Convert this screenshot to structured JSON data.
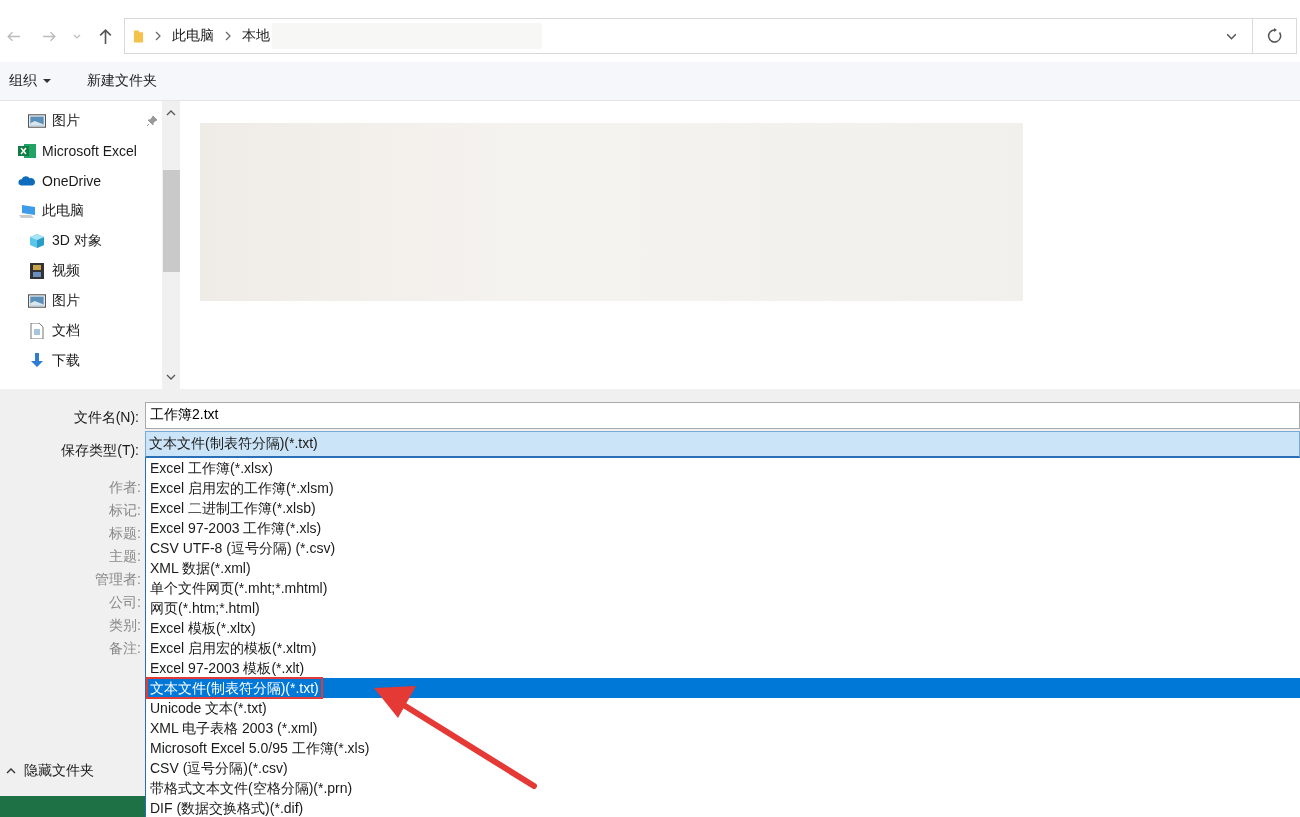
{
  "address_bar": {
    "breadcrumbs": [
      "此电脑",
      "本地"
    ]
  },
  "toolbar": {
    "organize": "组织",
    "new_folder": "新建文件夹"
  },
  "nav_pane": {
    "items": [
      {
        "label": "图片",
        "kind": "pictures",
        "pinned": true
      },
      {
        "label": "Microsoft Excel",
        "kind": "excel",
        "pinned": false
      },
      {
        "label": "OneDrive",
        "kind": "cloud",
        "pinned": false
      },
      {
        "label": "此电脑",
        "kind": "computer",
        "pinned": false,
        "children": [
          {
            "label": "3D 对象",
            "kind": "cube",
            "pinned": false
          },
          {
            "label": "视频",
            "kind": "video",
            "pinned": false
          },
          {
            "label": "图片",
            "kind": "pictures",
            "pinned": false
          },
          {
            "label": "文档",
            "kind": "document",
            "pinned": false
          },
          {
            "label": "下载",
            "kind": "download",
            "pinned": false
          }
        ]
      }
    ]
  },
  "form": {
    "file_name_label": "文件名(N):",
    "file_name": "工作簿2.txt",
    "save_type_label": "保存类型(T):",
    "save_type": "文本文件(制表符分隔)(*.txt)",
    "meta_labels": [
      "作者:",
      "标记:",
      "标题:",
      "主题:",
      "管理者:",
      "公司:",
      "类别:",
      "备注:"
    ],
    "hide_folders": "隐藏文件夹"
  },
  "type_list": [
    {
      "label": "Excel 工作簿(*.xlsx)",
      "selected": false
    },
    {
      "label": "Excel 启用宏的工作簿(*.xlsm)",
      "selected": false
    },
    {
      "label": "Excel 二进制工作簿(*.xlsb)",
      "selected": false
    },
    {
      "label": "Excel 97-2003 工作簿(*.xls)",
      "selected": false
    },
    {
      "label": "CSV UTF-8 (逗号分隔) (*.csv)",
      "selected": false
    },
    {
      "label": "XML 数据(*.xml)",
      "selected": false
    },
    {
      "label": "单个文件网页(*.mht;*.mhtml)",
      "selected": false
    },
    {
      "label": "网页(*.htm;*.html)",
      "selected": false
    },
    {
      "label": "Excel 模板(*.xltx)",
      "selected": false
    },
    {
      "label": "Excel 启用宏的模板(*.xltm)",
      "selected": false
    },
    {
      "label": "Excel 97-2003 模板(*.xlt)",
      "selected": false
    },
    {
      "label": "文本文件(制表符分隔)(*.txt)",
      "selected": true
    },
    {
      "label": "Unicode 文本(*.txt)",
      "selected": false
    },
    {
      "label": "XML 电子表格 2003 (*.xml)",
      "selected": false
    },
    {
      "label": "Microsoft Excel 5.0/95 工作簿(*.xls)",
      "selected": false
    },
    {
      "label": "CSV (逗号分隔)(*.csv)",
      "selected": false
    },
    {
      "label": "带格式文本文件(空格分隔)(*.prn)",
      "selected": false
    },
    {
      "label": "DIF (数据交换格式)(*.dif)",
      "selected": false
    }
  ]
}
